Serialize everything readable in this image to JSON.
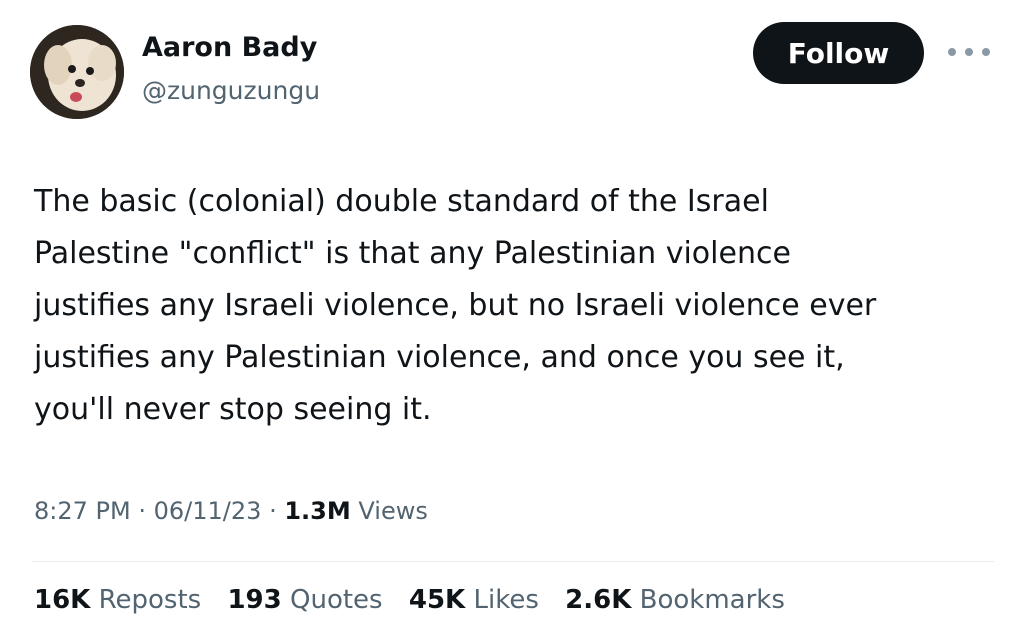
{
  "author": {
    "display_name": "Aaron Bady",
    "handle": "@zunguzungu"
  },
  "actions": {
    "follow_label": "Follow",
    "more_icon": "more-horizontal-icon"
  },
  "tweet": {
    "text": "The basic (colonial) double standard of the Israel\nPalestine \"conflict\" is that any Palestinian violence\njustifies any Israeli violence, but no Israeli violence ever\njustifies any Palestinian violence, and once you see it,\nyou'll never stop seeing it."
  },
  "meta": {
    "time": "8:27 PM",
    "separator": "·",
    "date": "06/11/23",
    "views_count": "1.3M",
    "views_label": "Views"
  },
  "stats": {
    "reposts": {
      "count": "16K",
      "label": "Reposts"
    },
    "quotes": {
      "count": "193",
      "label": "Quotes"
    },
    "likes": {
      "count": "45K",
      "label": "Likes"
    },
    "bookmarks": {
      "count": "2.6K",
      "label": "Bookmarks"
    }
  },
  "colors": {
    "follow_bg": "#0f1419",
    "secondary_text": "#536471"
  }
}
